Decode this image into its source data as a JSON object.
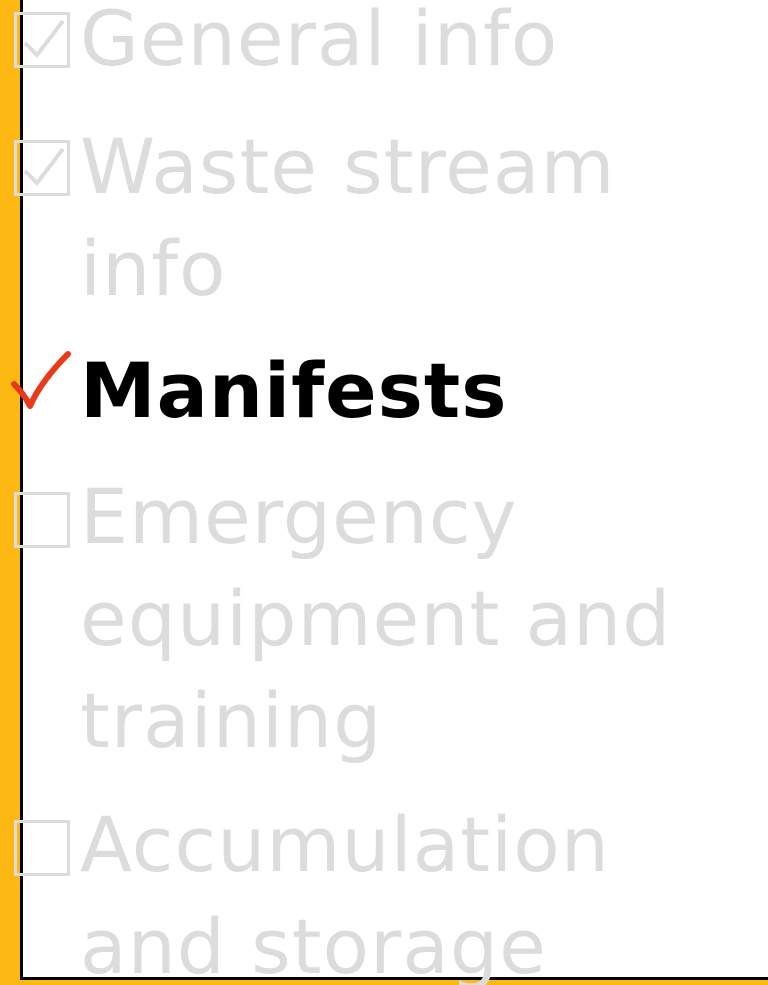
{
  "checklist": {
    "items": [
      {
        "label": "General info",
        "state": "done",
        "icon": "checked-box-icon"
      },
      {
        "label": "Waste stream info",
        "state": "done",
        "icon": "checked-box-icon"
      },
      {
        "label": "Manifests",
        "state": "current",
        "icon": "red-checkmark-icon"
      },
      {
        "label": "Emergency equipment and training",
        "state": "pending",
        "icon": "empty-box-icon"
      },
      {
        "label": "Accumulation and storage",
        "state": "pending",
        "icon": "empty-box-icon"
      }
    ]
  },
  "colors": {
    "accent_bar": "#FDB813",
    "inactive_text": "#DCDCDC",
    "active_text": "#000000",
    "checkmark": "#E8391A"
  }
}
